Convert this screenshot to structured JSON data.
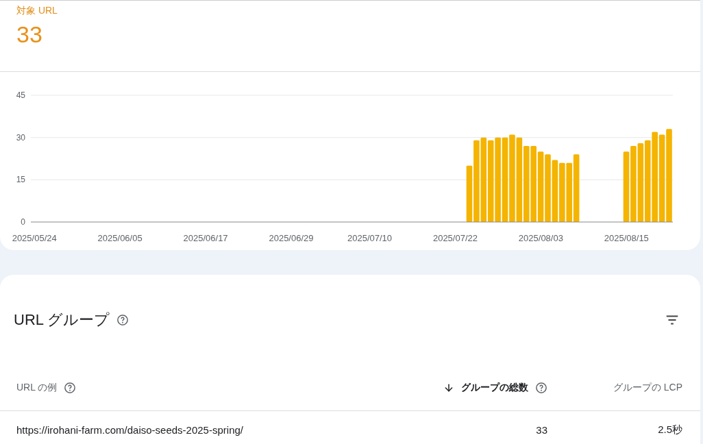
{
  "summary": {
    "label": "対象 URL",
    "value": "33"
  },
  "chart_data": {
    "type": "bar",
    "ylim": [
      0,
      45
    ],
    "yticks": [
      0,
      15,
      30,
      45
    ],
    "categories": [
      "2025/05/24",
      null,
      null,
      null,
      null,
      null,
      null,
      null,
      null,
      null,
      null,
      null,
      "2025/06/05",
      null,
      null,
      null,
      null,
      null,
      null,
      null,
      null,
      null,
      null,
      null,
      "2025/06/17",
      null,
      null,
      null,
      null,
      null,
      null,
      null,
      null,
      null,
      null,
      null,
      "2025/06/29",
      null,
      null,
      null,
      null,
      null,
      null,
      null,
      null,
      null,
      null,
      "2025/07/10",
      null,
      null,
      null,
      null,
      null,
      null,
      null,
      null,
      null,
      null,
      null,
      "2025/07/22",
      null,
      null,
      null,
      null,
      null,
      null,
      null,
      null,
      null,
      null,
      null,
      "2025/08/03",
      null,
      null,
      null,
      null,
      null,
      null,
      null,
      null,
      null,
      null,
      null,
      "2025/08/15",
      null,
      null,
      null,
      null,
      null,
      null
    ],
    "series": [
      {
        "color": "#f4b400",
        "values": [
          null,
          null,
          null,
          null,
          null,
          null,
          null,
          null,
          null,
          null,
          null,
          null,
          null,
          null,
          null,
          null,
          null,
          null,
          null,
          null,
          null,
          null,
          null,
          null,
          null,
          null,
          null,
          null,
          null,
          null,
          null,
          null,
          null,
          null,
          null,
          null,
          null,
          null,
          null,
          null,
          null,
          null,
          null,
          null,
          null,
          null,
          null,
          null,
          null,
          null,
          null,
          null,
          null,
          null,
          null,
          null,
          null,
          null,
          null,
          null,
          null,
          20,
          29,
          30,
          29,
          30,
          30,
          31,
          30,
          27,
          27,
          25,
          24,
          22,
          21,
          21,
          24,
          null,
          null,
          null,
          null,
          null,
          null,
          25,
          27,
          28,
          29,
          32,
          31,
          33
        ]
      }
    ]
  },
  "url_groups": {
    "title": "URL グループ",
    "columns": [
      {
        "label": "URL の例",
        "help": true,
        "sorted": false
      },
      {
        "label": "グループの総数",
        "help": true,
        "sorted": true
      },
      {
        "label": "グループの LCP",
        "help": false,
        "sorted": false
      }
    ],
    "rows": [
      [
        "https://irohani-farm.com/daiso-seeds-2025-spring/",
        "33",
        "2.5秒"
      ]
    ]
  }
}
